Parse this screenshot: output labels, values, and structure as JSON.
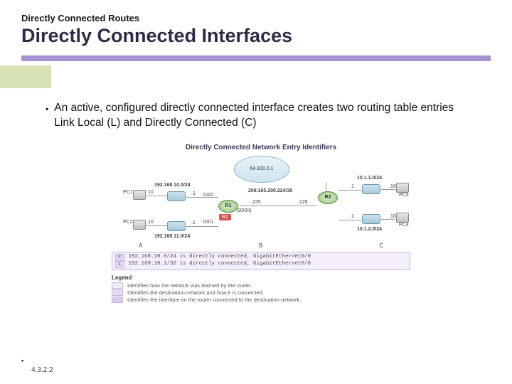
{
  "header": {
    "subtitle": "Directly Connected Routes",
    "title": "Directly Connected Interfaces"
  },
  "bullet": {
    "text": "An active, configured directly connected interface creates two routing table entries Link Local  (L) and Directly Connected (C)"
  },
  "diagram": {
    "title": "Directly Connected Network Entry Identifiers",
    "cloud_ip": "64.100.0.1",
    "r1": "R1",
    "r2": "R2",
    "pc1": "PC1",
    "pc2": "PC2",
    "pc3": "PC3",
    "pc4": "PC4",
    "net1": "192.168.10.0/24",
    "net2": "192.168.11.0/24",
    "net3": "10.1.1.0/24",
    "net4": "10.1.2.0/24",
    "wan": "209.165.200.224/30",
    "host10": ".10",
    "host1": ".1",
    "g00": "G0/0",
    "g01": "G0/1",
    "s000": "S0/0/0",
    "wan225": ".225",
    "wan226": ".226",
    "colA": "A",
    "colB": "B",
    "colC": "C",
    "route1_code": "C",
    "route1_text": "192.168.10.0/24 is directly connected, GigabitEthernet0/0",
    "route2_code": "L",
    "route2_text": "192.168.10.1/32 is directly connected, GigabitEthernet0/0",
    "legend_title": "Legend",
    "legend1": "Identifies how the network was learned by the router.",
    "legend2": "Identifies the destination network and how it is connected.",
    "legend3": "Identifies the interface on the router connected to the destination network."
  },
  "reference": "4.3.2.2"
}
